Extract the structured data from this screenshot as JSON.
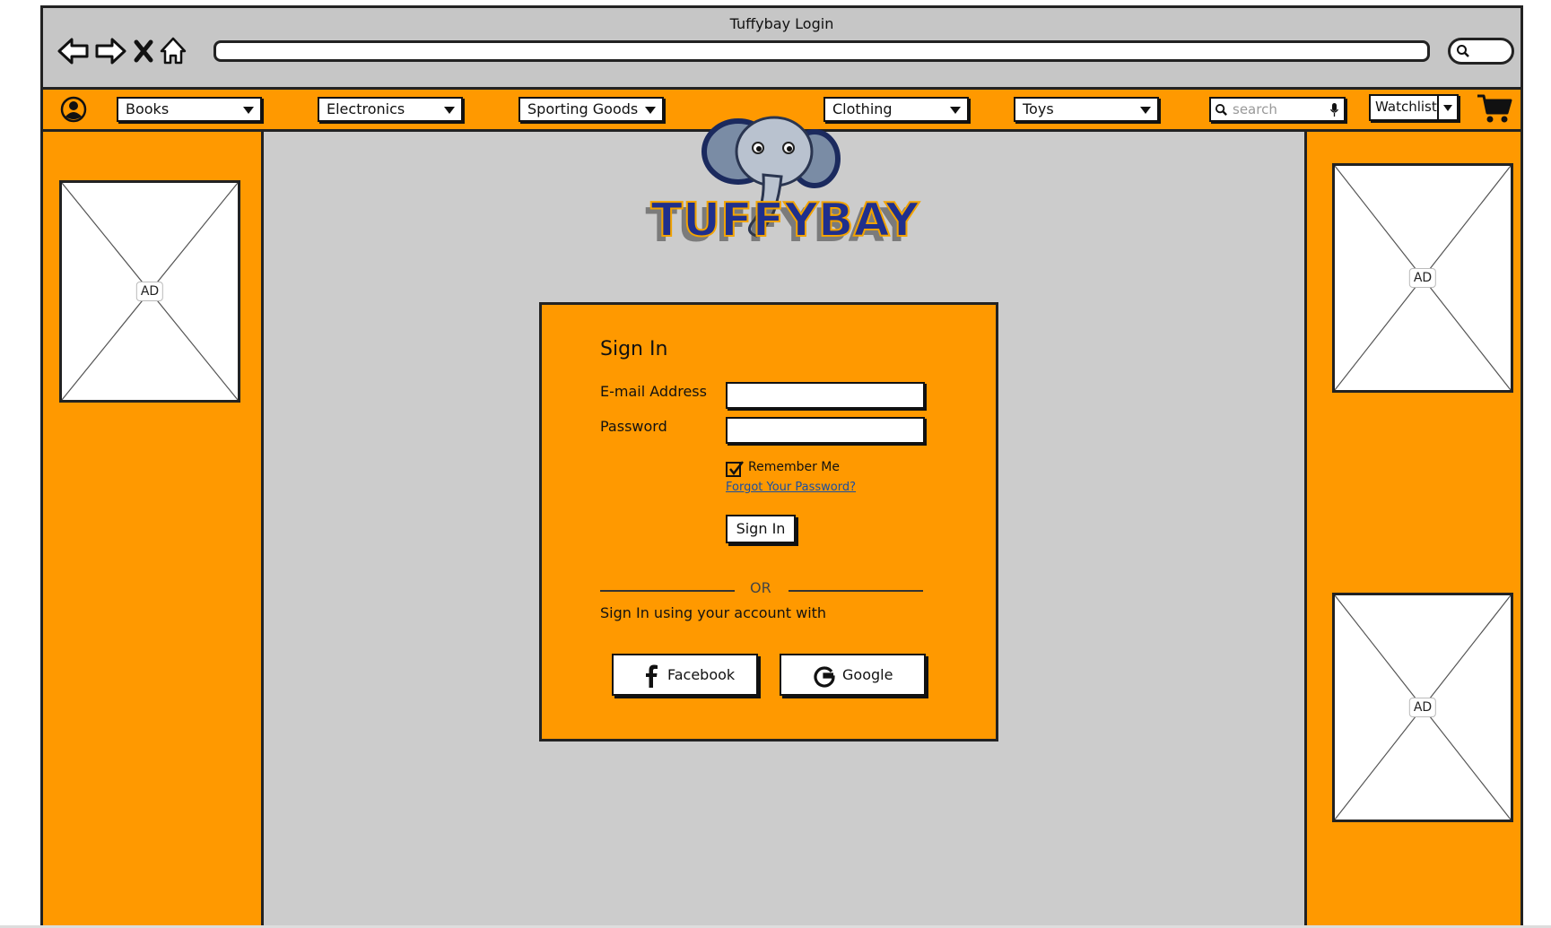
{
  "window": {
    "title": "Tuffybay Login"
  },
  "browser": {
    "back_icon": "back-arrow-icon",
    "forward_icon": "forward-arrow-icon",
    "stop_icon": "stop-icon",
    "home_icon": "home-icon",
    "search_icon": "search-icon"
  },
  "nav": {
    "categories": [
      "Books",
      "Electronics",
      "Sporting Goods",
      "Clothing",
      "Toys"
    ],
    "search_placeholder": "search",
    "watchlist_label": "Watchlist",
    "cart_icon": "cart-icon",
    "account_icon": "user-circle-icon"
  },
  "logo": {
    "text": "TUFFYBAY"
  },
  "ads": {
    "label": "AD"
  },
  "signin": {
    "title": "Sign In",
    "email_label": "E-mail Address",
    "email_value": "",
    "password_label": "Password",
    "password_value": "",
    "remember_label": "Remember Me",
    "remember_checked": true,
    "forgot_link": "Forgot Your Password?",
    "submit_label": "Sign In",
    "or_text": "OR",
    "alt_text": "Sign In using your account with",
    "facebook_label": "Facebook",
    "google_label": "Google"
  },
  "colors": {
    "accent": "#ff9900",
    "canvas": "#cccccc",
    "chrome": "#c6c6c6",
    "link": "#1a4fa0",
    "logo_text": "#1f2f8c"
  }
}
